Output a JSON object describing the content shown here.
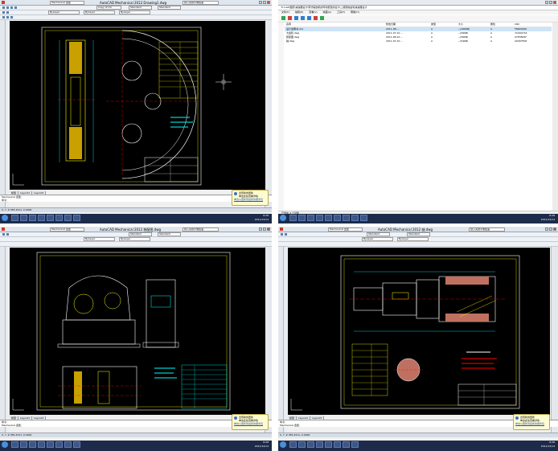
{
  "app": {
    "title": "AutoCAD Mechanical 2012",
    "workspace": "Mechanical 选型",
    "search_placeholder": "键入关键字或短语"
  },
  "quadrants": {
    "q1": {
      "title": "AutoCAD Mechanical 2012    Drawing1.dwg",
      "layer": "Copy of CO",
      "style": "Standard",
      "linetype": "ByLayer",
      "tabs": [
        "模型",
        "Layout1",
        "Layout2"
      ],
      "cmd_line1": "Mechanical 选型：",
      "cmd_line2": "命令：",
      "status": "X, Y, Z  355.4311,  0.0000",
      "title_block": "轮齿设计"
    },
    "q2": {
      "address": "E:\\cad\\图纸\\减速器设计\\带式输送机的传动装置的设计\\二级圆柱齿轮减速器设计",
      "menu": [
        "文件(F)",
        "编辑(E)",
        "查看(V)",
        "收藏(A)",
        "工具(T)",
        "帮助(H)"
      ],
      "headers": [
        "名称",
        "修改日期",
        "类型",
        "大小",
        "属性",
        "CRC"
      ],
      "files": [
        {
          "name": "设计说明书.doc",
          "date": "2011-08-...",
          "type": "A",
          "size": "--(296KB)",
          "attr": "A",
          "crc": "F8000206"
        },
        {
          "name": "大齿轮.dwg",
          "date": "2011-07-10 ...",
          "type": "A",
          "size": "--(59KB)",
          "attr": "A",
          "crc": "7C090716"
        },
        {
          "name": "装配图.dwg",
          "date": "2011-08-10 ...",
          "type": "A",
          "size": "--(56KB)",
          "attr": "A",
          "crc": "07F0B43F"
        },
        {
          "name": "轴.dwg",
          "date": "2011-07-10 ...",
          "type": "A",
          "size": "--(54KB)",
          "attr": "A",
          "crc": "A0007E00"
        }
      ],
      "status": "已选中 4 个对象"
    },
    "q3": {
      "title": "AutoCAD Mechanical 2012    装配图.dwg",
      "tabs": [
        "模型",
        "Layout1",
        "Layout2"
      ],
      "cmd_line1": "命令：",
      "cmd_line2": "Mechanical 选型：",
      "status": "X, Y, Z  355.4311,  0.0000"
    },
    "q4": {
      "title": "AutoCAD Mechanical 2012    轴.dwg",
      "tabs": [
        "模型",
        "Layout1",
        "Layout2"
      ],
      "cmd_line1": "命令：",
      "cmd_line2": "Mechanical 选型：",
      "status": "X, Y, Z  355.4311,  0.0000"
    }
  },
  "balloon": {
    "title": "出现新的更新",
    "line1": "单击此处查看详情",
    "link": "单击以更新到最新的服务包"
  },
  "taskbar": {
    "time": "8:28",
    "date": "2011/12/14"
  },
  "colors": {
    "canvas": "#000000",
    "outline": "#ffff00",
    "cyan": "#00ffff",
    "white": "#ffffff",
    "red": "#ff0000",
    "green": "#00ff00"
  }
}
